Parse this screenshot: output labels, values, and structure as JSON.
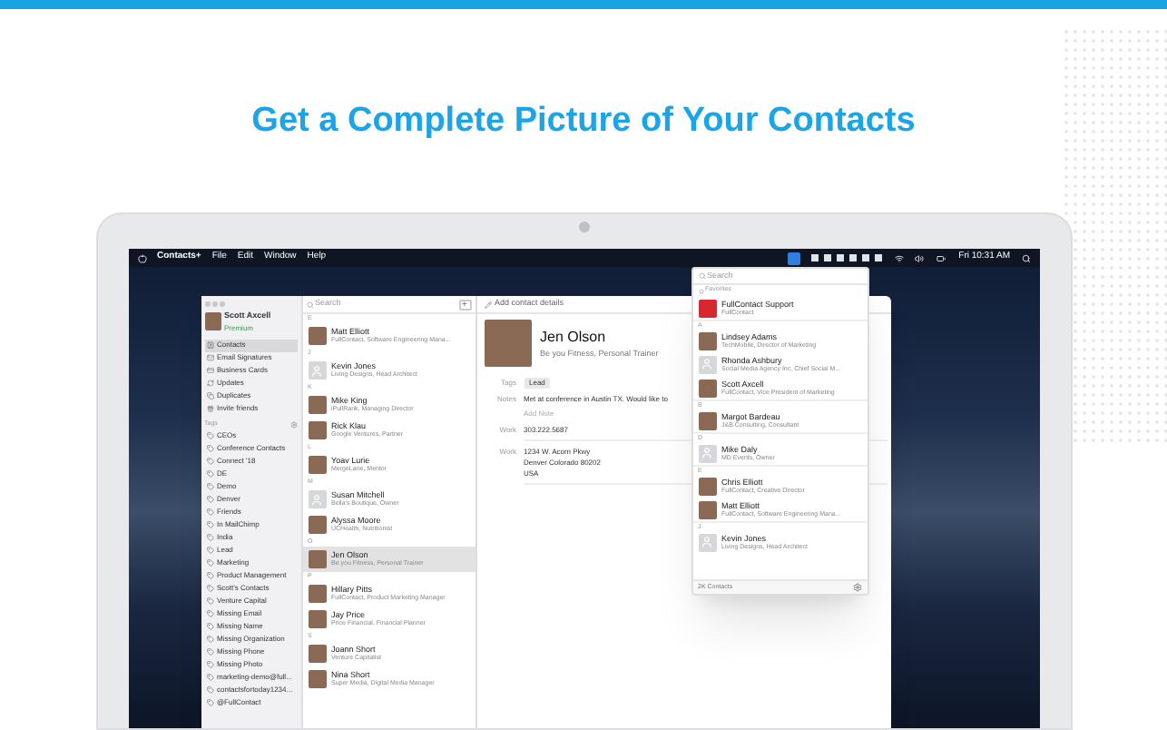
{
  "headline": "Get a Complete Picture of Your Contacts",
  "menu_bar": {
    "app": "Contacts+",
    "menus": [
      "File",
      "Edit",
      "Window",
      "Help"
    ],
    "clock": "Fri 10:31 AM"
  },
  "sidebar": {
    "user": {
      "name": "Scott Axcell",
      "plan": "Premium"
    },
    "items": [
      {
        "label": "Contacts",
        "selected": true
      },
      {
        "label": "Email Signatures",
        "selected": false
      },
      {
        "label": "Business Cards",
        "selected": false
      },
      {
        "label": "Updates",
        "selected": false
      },
      {
        "label": "Duplicates",
        "selected": false
      },
      {
        "label": "Invite friends",
        "selected": false
      }
    ],
    "tags_header": "Tags",
    "tags": [
      "CEOs",
      "Conference Contacts",
      "Connect '18",
      "DE",
      "Demo",
      "Denver",
      "Friends",
      "In MailChimp",
      "India",
      "Lead",
      "Marketing",
      "Product Management",
      "Scott's Contacts",
      "Venture Capital",
      "Missing Email",
      "Missing Name",
      "Missing Organization",
      "Missing Phone",
      "Missing Photo",
      "marketing-demo@full...",
      "contactsfortoday1234...",
      "@FullContact"
    ]
  },
  "contact_list": {
    "search": {
      "placeholder": "Search"
    },
    "add": "+",
    "groups": [
      {
        "letter": "E",
        "contacts": [
          {
            "name": "Matt Elliott",
            "subtitle": "FullContact, Software Engineering Mana...",
            "photo": true,
            "selected": false
          }
        ]
      },
      {
        "letter": "J",
        "contacts": [
          {
            "name": "Kevin Jones",
            "subtitle": "Living Designs, Head Architect",
            "photo": false,
            "selected": false
          }
        ]
      },
      {
        "letter": "K",
        "contacts": [
          {
            "name": "Mike King",
            "subtitle": "iPullRank, Managing Director",
            "photo": true,
            "selected": false
          },
          {
            "name": "Rick Klau",
            "subtitle": "Google Ventures, Partner",
            "photo": true,
            "selected": false
          }
        ]
      },
      {
        "letter": "L",
        "contacts": [
          {
            "name": "Yoav Lurie",
            "subtitle": "MergeLane, Mentor",
            "photo": true,
            "selected": false
          }
        ]
      },
      {
        "letter": "M",
        "contacts": [
          {
            "name": "Susan Mitchell",
            "subtitle": "Bella's Boutique, Owner",
            "photo": false,
            "selected": false
          },
          {
            "name": "Alyssa Moore",
            "subtitle": "UCHealth, Nutritionist",
            "photo": true,
            "selected": false
          }
        ]
      },
      {
        "letter": "O",
        "contacts": [
          {
            "name": "Jen Olson",
            "subtitle": "Be you Fitness, Personal Trainer",
            "photo": true,
            "selected": true
          }
        ]
      },
      {
        "letter": "P",
        "contacts": [
          {
            "name": "Hillary Pitts",
            "subtitle": "FullContact, Product Marketing Manager",
            "photo": true,
            "selected": false
          },
          {
            "name": "Jay Price",
            "subtitle": "Price Financial, Financial Planner",
            "photo": true,
            "selected": false
          }
        ]
      },
      {
        "letter": "S",
        "contacts": [
          {
            "name": "Joann Short",
            "subtitle": "Venture Capitalist",
            "photo": true,
            "selected": false
          },
          {
            "name": "Nina Short",
            "subtitle": "Super Media, Digital Media Manager",
            "photo": true,
            "selected": false
          }
        ]
      }
    ]
  },
  "detail": {
    "add_details": "Add contact details",
    "name": "Jen Olson",
    "subtitle": "Be you Fitness, Personal Trainer",
    "tags_label": "Tags",
    "tag": "Lead",
    "notes_label": "Notes",
    "note": "Met at conference in Austin TX. Would like to",
    "add_note": "Add Note",
    "fields": [
      {
        "label": "Work",
        "lines": [
          "303.222.5687"
        ]
      },
      {
        "label": "Work",
        "lines": [
          "1234 W. Acorn Pkwy",
          "Denver Colorado 80202",
          "USA"
        ]
      }
    ]
  },
  "popover": {
    "search": {
      "placeholder": "Search"
    },
    "favorites_header": "Favorites",
    "favorite": {
      "name": "FullContact Support",
      "subtitle": "FullContact"
    },
    "groups": [
      {
        "letter": "A",
        "contacts": [
          {
            "name": "Lindsey Adams",
            "subtitle": "TechMobile, Director of Marketing",
            "photo": true
          },
          {
            "name": "Rhonda Ashbury",
            "subtitle": "Social Media Agency Inc, Chief Social M...",
            "photo": false
          },
          {
            "name": "Scott Axcell",
            "subtitle": "FullContact, Vice President of Marketing",
            "photo": true
          }
        ]
      },
      {
        "letter": "B",
        "contacts": [
          {
            "name": "Margot Bardeau",
            "subtitle": "J&B Consulting, Consultant",
            "photo": true
          }
        ]
      },
      {
        "letter": "D",
        "contacts": [
          {
            "name": "Mike Daly",
            "subtitle": "MD Events, Owner",
            "photo": false
          }
        ]
      },
      {
        "letter": "E",
        "contacts": [
          {
            "name": "Chris Elliott",
            "subtitle": "FullContact, Creative Director",
            "photo": true
          },
          {
            "name": "Matt Elliott",
            "subtitle": "FullContact, Software Engineering Mana...",
            "photo": true
          }
        ]
      },
      {
        "letter": "J",
        "contacts": [
          {
            "name": "Kevin Jones",
            "subtitle": "Living Designs, Head Architect",
            "photo": false
          }
        ]
      }
    ],
    "footer": "2K Contacts"
  }
}
